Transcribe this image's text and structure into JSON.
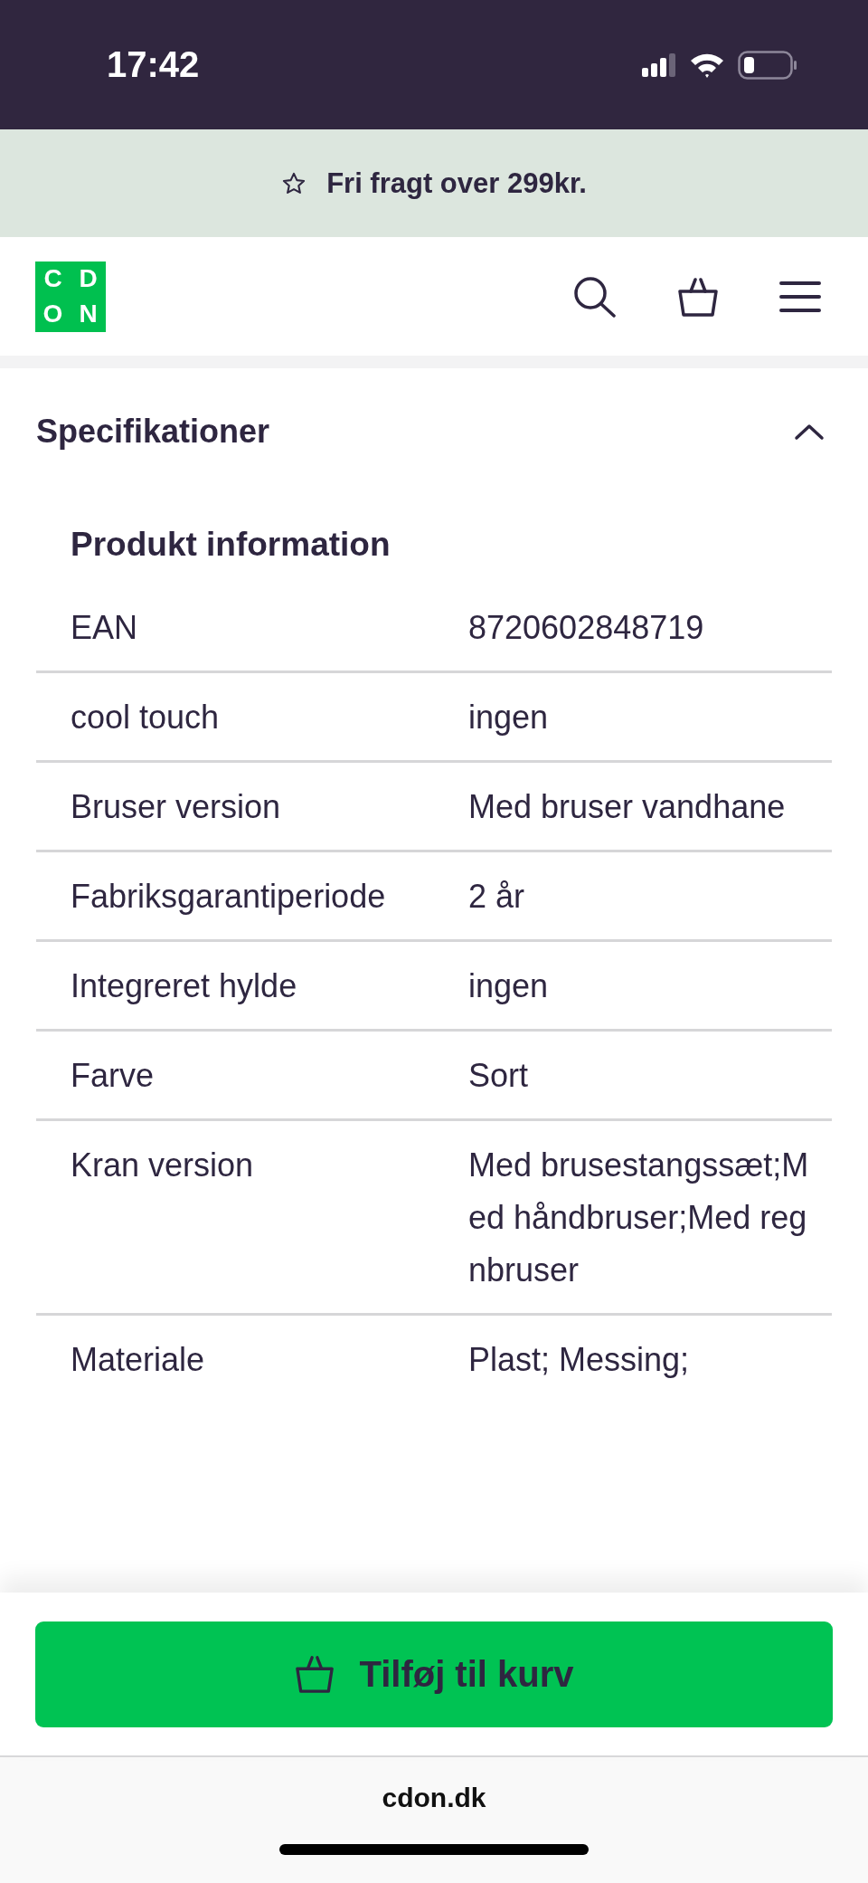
{
  "status_bar": {
    "time": "17:42"
  },
  "promo_banner": {
    "text": "Fri fragt over 299kr."
  },
  "header": {
    "logo_letters": [
      "C",
      "D",
      "O",
      "N"
    ]
  },
  "section": {
    "title": "Specifikationer",
    "expanded": true,
    "subtitle": "Produkt information",
    "rows": [
      {
        "label": "EAN",
        "value": "8720602848719"
      },
      {
        "label": "cool touch",
        "value": "ingen"
      },
      {
        "label": "Bruser version",
        "value": "Med bruser vandhane"
      },
      {
        "label": "Fabriksgarantiperiode",
        "value": "2 år"
      },
      {
        "label": "Integreret hylde",
        "value": "ingen"
      },
      {
        "label": "Farve",
        "value": "Sort"
      },
      {
        "label": "Kran version",
        "value": "Med brusestangssæt;Med håndbruser;Med regnbruser"
      },
      {
        "label": "Materiale",
        "value": "Plast; Messing;"
      }
    ]
  },
  "add_to_cart_button": {
    "label": "Tilføj til kurv"
  },
  "browser_bar": {
    "domain": "cdon.dk"
  }
}
